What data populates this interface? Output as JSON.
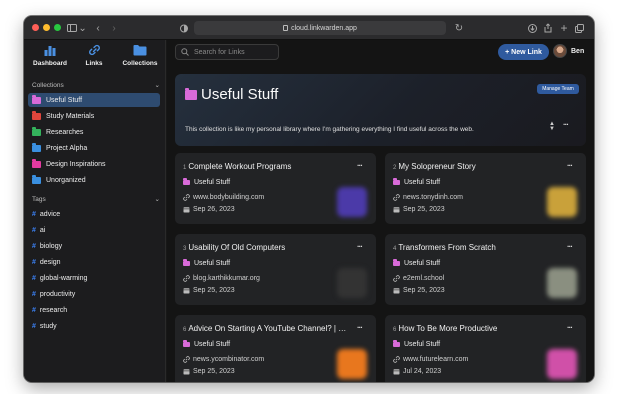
{
  "browser": {
    "url": "cloud.linkwarden.app"
  },
  "topnav": {
    "dashboard": "Dashboard",
    "links": "Links",
    "collections": "Collections"
  },
  "sidebar": {
    "collections_header": "Collections",
    "collections": [
      {
        "label": "Useful Stuff",
        "color": "#d86ad8"
      },
      {
        "label": "Study Materials",
        "color": "#e0453c"
      },
      {
        "label": "Researches",
        "color": "#34b25c"
      },
      {
        "label": "Project Alpha",
        "color": "#3a8fe0"
      },
      {
        "label": "Design Inspirations",
        "color": "#e43aa0"
      },
      {
        "label": "Unorganized",
        "color": "#3a8fe0"
      }
    ],
    "tags_header": "Tags",
    "tags": [
      "advice",
      "ai",
      "biology",
      "design",
      "global-warming",
      "productivity",
      "research",
      "study"
    ]
  },
  "header": {
    "search_placeholder": "Search for Links",
    "new_link": "+ New Link",
    "username": "Ben"
  },
  "collection": {
    "title": "Useful Stuff",
    "manage_team": "Manage Team",
    "description": "This collection is like my personal library where I'm gathering everything I find useful across the web."
  },
  "cards": [
    {
      "index": "1",
      "title": "Complete Workout Programs",
      "collection": "Useful Stuff",
      "url": "www.bodybuilding.com",
      "date": "Sep 26, 2023",
      "thumb": "#4b3aa8"
    },
    {
      "index": "2",
      "title": "My Solopreneur Story",
      "collection": "Useful Stuff",
      "url": "news.tonydinh.com",
      "date": "Sep 25, 2023",
      "thumb": "#c9a13a"
    },
    {
      "index": "3",
      "title": "Usability Of Old Computers",
      "collection": "Useful Stuff",
      "url": "blog.karthikkumar.org",
      "date": "Sep 25, 2023",
      "thumb": "#333333"
    },
    {
      "index": "4",
      "title": "Transformers From Scratch",
      "collection": "Useful Stuff",
      "url": "e2eml.school",
      "date": "Sep 25, 2023",
      "thumb": "#8a8f80"
    },
    {
      "index": "6",
      "title": "Advice On Starting A YouTube Channel? | Ha...",
      "collection": "Useful Stuff",
      "url": "news.ycombinator.com",
      "date": "Sep 25, 2023",
      "thumb": "#e8771e"
    },
    {
      "index": "6",
      "title": "How To Be More Productive",
      "collection": "Useful Stuff",
      "url": "www.futurelearn.com",
      "date": "Jul 24, 2023",
      "thumb": "#d050a8"
    }
  ]
}
